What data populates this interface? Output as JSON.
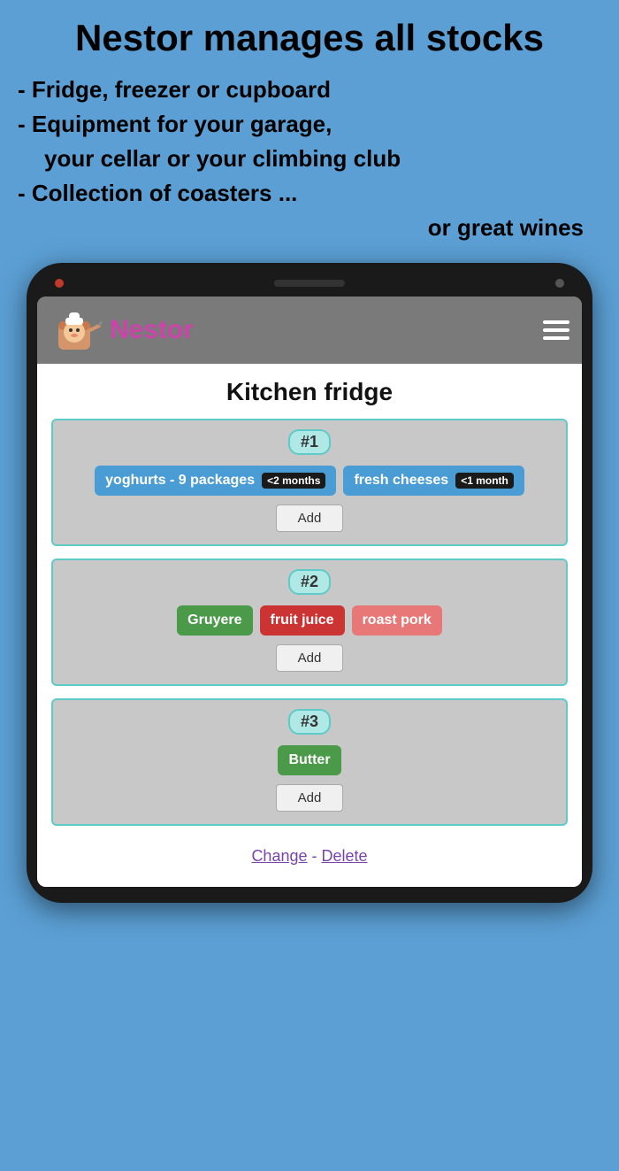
{
  "header": {
    "title": "Nestor manages all stocks",
    "bullets": [
      "- Fridge, freezer or cupboard",
      "- Equipment for your garage,",
      "  your cellar or your climbing club",
      "- Collection of coasters ..."
    ],
    "or_line": "or great wines"
  },
  "app": {
    "title": "Nestor",
    "page_title": "Kitchen fridge",
    "hamburger_label": "menu"
  },
  "shelves": [
    {
      "number": "#1",
      "items": [
        {
          "label": "yoghurts - 9 packages",
          "expiry": "<2 months",
          "color": "blue"
        },
        {
          "label": "fresh cheeses",
          "expiry": "<1 month",
          "color": "blue"
        }
      ],
      "add_label": "Add"
    },
    {
      "number": "#2",
      "items": [
        {
          "label": "Gruyere",
          "expiry": null,
          "color": "green"
        },
        {
          "label": "fruit juice",
          "expiry": null,
          "color": "red"
        },
        {
          "label": "roast pork",
          "expiry": null,
          "color": "pink"
        }
      ],
      "add_label": "Add"
    },
    {
      "number": "#3",
      "items": [
        {
          "label": "Butter",
          "expiry": null,
          "color": "green"
        }
      ],
      "add_label": "Add"
    }
  ],
  "bottom_links": {
    "change": "Change",
    "separator": " - ",
    "delete": "Delete"
  }
}
